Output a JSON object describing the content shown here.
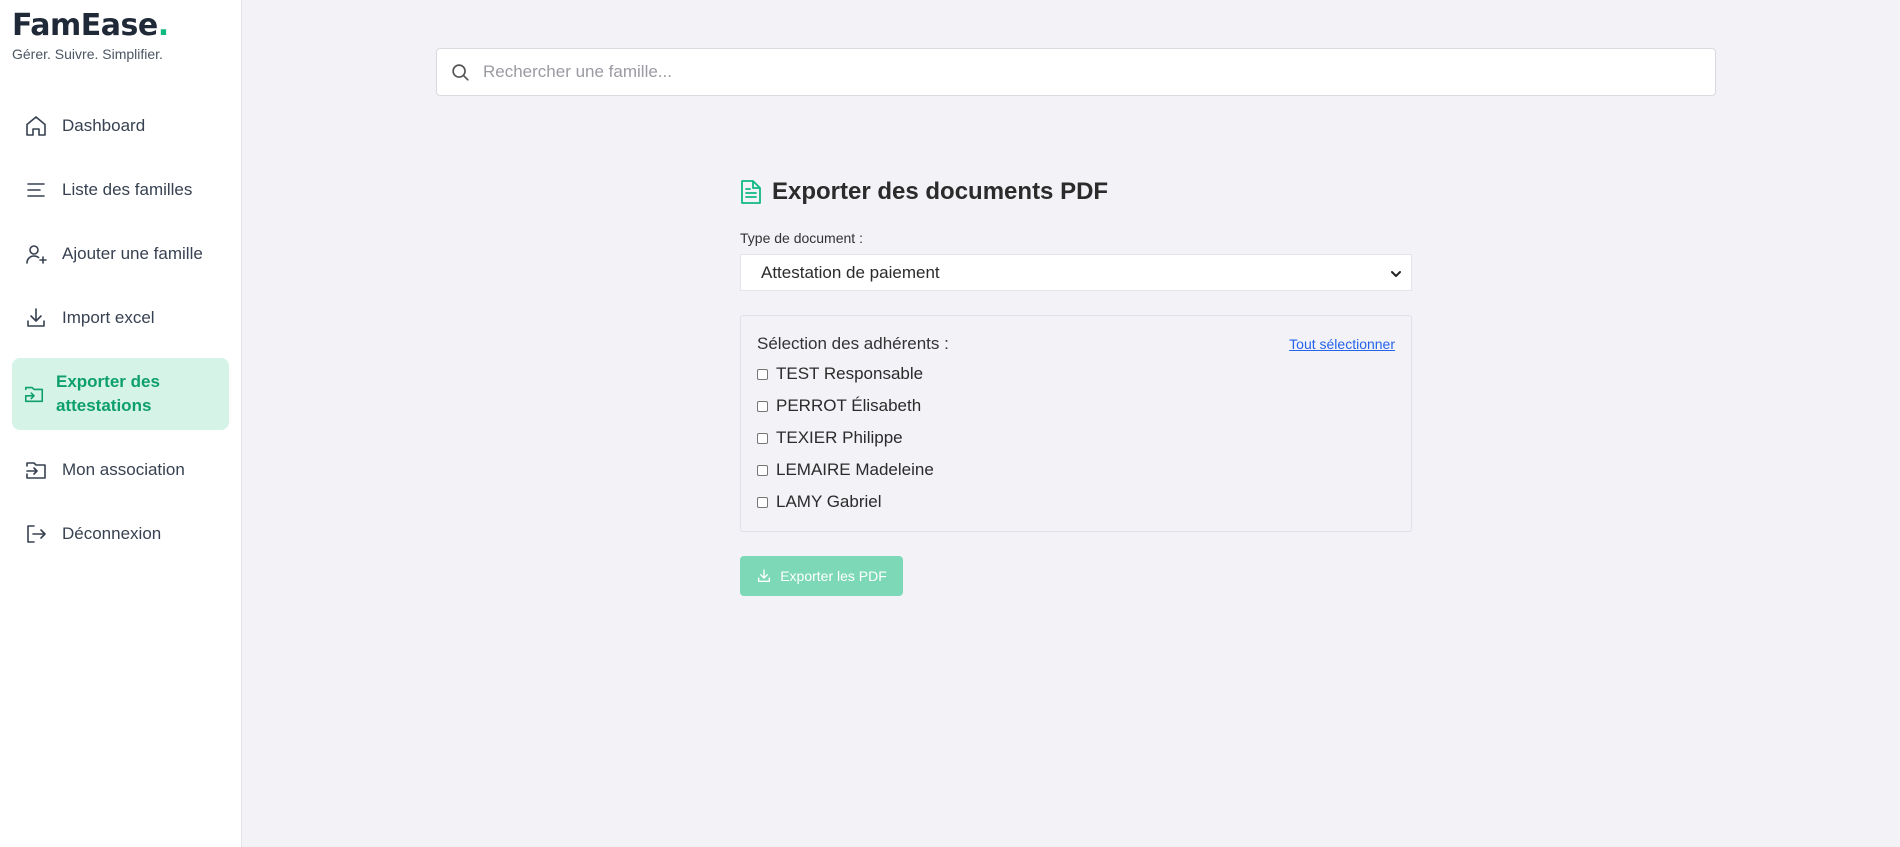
{
  "brand": {
    "name": "FamEase",
    "dot": ".",
    "tagline": "Gérer. Suivre. Simplifier."
  },
  "sidebar": {
    "items": [
      {
        "label": "Dashboard",
        "icon": "home-icon"
      },
      {
        "label": "Liste des familles",
        "icon": "list-icon"
      },
      {
        "label": "Ajouter une famille",
        "icon": "user-plus-icon"
      },
      {
        "label": "Import excel",
        "icon": "download-icon"
      },
      {
        "label": "Exporter des attestations",
        "icon": "export-icon",
        "active": true
      },
      {
        "label": "Mon association",
        "icon": "login-icon"
      },
      {
        "label": "Déconnexion",
        "icon": "logout-icon"
      }
    ]
  },
  "search": {
    "placeholder": "Rechercher une famille...",
    "value": ""
  },
  "export": {
    "title": "Exporter des documents PDF",
    "doc_type_label": "Type de document :",
    "doc_type_selected": "Attestation de paiement",
    "members_label": "Sélection des adhérents :",
    "select_all": "Tout sélectionner",
    "members": [
      {
        "name": "TEST Responsable",
        "checked": false
      },
      {
        "name": "PERROT Élisabeth",
        "checked": false
      },
      {
        "name": "TEXIER Philippe",
        "checked": false
      },
      {
        "name": "LEMAIRE Madeleine",
        "checked": false
      },
      {
        "name": "LAMY Gabriel",
        "checked": false
      }
    ],
    "button_label": "Exporter les PDF"
  },
  "colors": {
    "accent": "#10b981",
    "active_bg": "#d5f3e7",
    "button_bg": "#7dd8b7",
    "link": "#2563eb",
    "page_bg": "#f2f2f7"
  }
}
